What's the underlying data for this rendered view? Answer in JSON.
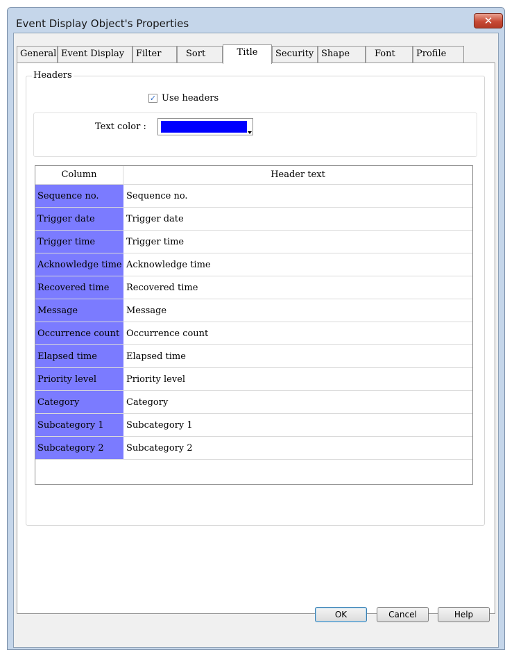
{
  "window": {
    "title": "Event Display Object's Properties",
    "close_glyph": "✕"
  },
  "tabs": [
    {
      "label": "General"
    },
    {
      "label": "Event Display"
    },
    {
      "label": "Filter"
    },
    {
      "label": "Sort"
    },
    {
      "label": "Title",
      "active": true
    },
    {
      "label": "Security"
    },
    {
      "label": "Shape"
    },
    {
      "label": "Font"
    },
    {
      "label": "Profile"
    }
  ],
  "headers_group": {
    "legend": "Headers",
    "use_headers_label": "Use headers",
    "use_headers_checked": true,
    "text_color_label": "Text color :",
    "text_color_value": "#0000ff"
  },
  "table": {
    "columns": [
      "Column",
      "Header text"
    ],
    "rows": [
      [
        "Sequence no.",
        "Sequence no."
      ],
      [
        "Trigger date",
        "Trigger date"
      ],
      [
        "Trigger time",
        "Trigger time"
      ],
      [
        "Acknowledge time",
        "Acknowledge time"
      ],
      [
        "Recovered time",
        "Recovered time"
      ],
      [
        "Message",
        "Message"
      ],
      [
        "Occurrence count",
        "Occurrence count"
      ],
      [
        "Elapsed time",
        "Elapsed time"
      ],
      [
        "Priority level",
        "Priority level"
      ],
      [
        "Category",
        "Category"
      ],
      [
        "Subcategory 1",
        "Subcategory 1"
      ],
      [
        "Subcategory 2",
        "Subcategory 2"
      ]
    ],
    "column_fill_color": "#7b7bff"
  },
  "buttons": {
    "ok": "OK",
    "cancel": "Cancel",
    "help": "Help"
  }
}
